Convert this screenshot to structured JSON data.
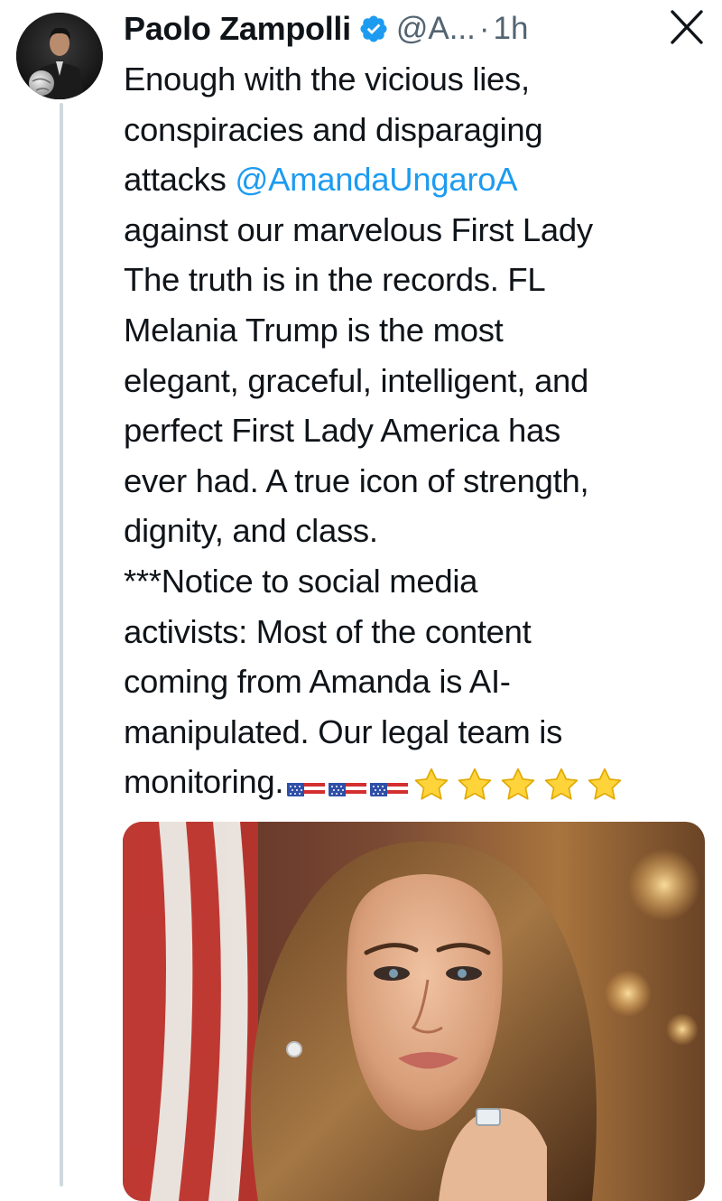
{
  "tweet": {
    "author": {
      "display_name": "Paolo Zampolli",
      "handle": "@A...",
      "verified": true,
      "avatar_icon": "avatar-photo"
    },
    "separator": "·",
    "time": "1h",
    "text_lines": {
      "l1": "Enough with the vicious lies,",
      "l2": "conspiracies and disparaging",
      "l3_prefix": "attacks ",
      "l3_mention": "@AmandaUngaroA",
      "l4": "against our marvelous First Lady",
      "l5": "The truth is in the records. FL",
      "l6": "Melania Trump is the most",
      "l7": "elegant, graceful, intelligent, and",
      "l8": "perfect First Lady America has",
      "l9": "ever had. A true icon of strength,",
      "l10": "dignity, and class.",
      "l11": "***Notice to social media",
      "l12": "activists: Most of the content",
      "l13": "coming from Amanda is AI-",
      "l14": "manipulated. Our legal team is",
      "l15": "monitoring."
    },
    "emojis": [
      "us-flag",
      "us-flag",
      "us-flag",
      "star",
      "star",
      "star",
      "star",
      "star"
    ],
    "media": {
      "type": "photo",
      "subject_icon": "portrait-photo"
    }
  },
  "controls": {
    "close_icon": "x-close-icon"
  },
  "colors": {
    "text": "#0f1419",
    "secondary": "#536471",
    "link": "#1d9bf0",
    "verified": "#1d9bf0",
    "thread_line": "#cfd9de",
    "background": "#ffffff"
  }
}
